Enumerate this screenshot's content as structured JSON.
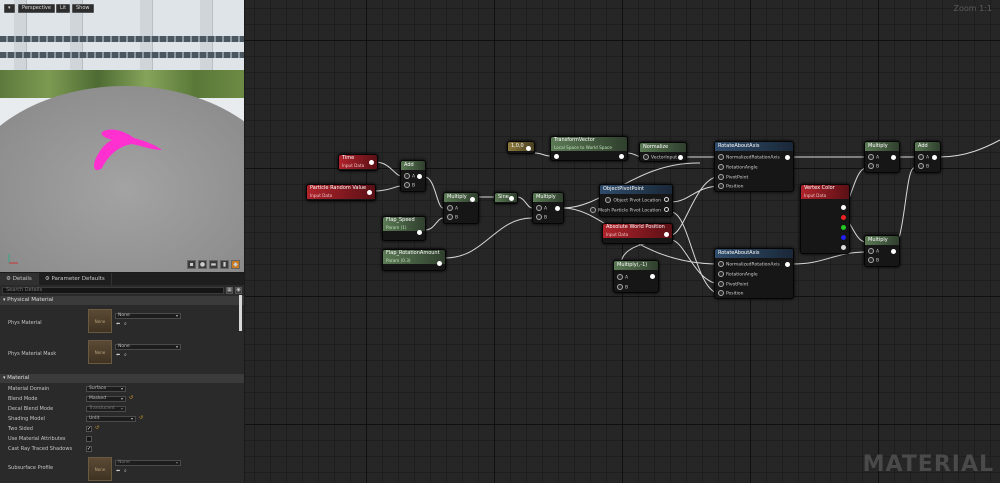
{
  "viewport": {
    "buttons": [
      "Perspective",
      "Lit",
      "Show"
    ]
  },
  "details_panel": {
    "tabs": [
      "Details",
      "Parameter Defaults"
    ],
    "search_placeholder": "Search Details",
    "physical_material": {
      "header": "Physical Material",
      "rows": [
        {
          "label": "Phys Material",
          "thumb": "None",
          "value": "None"
        },
        {
          "label": "Phys Material Mask",
          "thumb": "None",
          "value": "None"
        }
      ]
    },
    "material": {
      "header": "Material",
      "rows": [
        {
          "label": "Material Domain",
          "value": "Surface"
        },
        {
          "label": "Blend Mode",
          "value": "Masked"
        },
        {
          "label": "Decal Blend Mode",
          "value": "Translucent"
        },
        {
          "label": "Shading Model",
          "value": "Unlit"
        },
        {
          "label": "Two Sided",
          "checked": true
        },
        {
          "label": "Use Material Attributes",
          "checked": false
        },
        {
          "label": "Cast Ray Traced Shadows",
          "checked": true
        }
      ],
      "subsurface": {
        "label": "Subsurface Profile",
        "thumb": "None",
        "value": "None"
      }
    }
  },
  "graph": {
    "zoom": "Zoom 1:1",
    "watermark": "MATERIAL",
    "nodes": {
      "time": {
        "title": "Time",
        "subtitle": "Input Data"
      },
      "particle_random": {
        "title": "Particle Random Value",
        "subtitle": "Input Data"
      },
      "add1": {
        "title": "Add",
        "pins": [
          "A",
          "B"
        ]
      },
      "flap_speed": {
        "title": "Flap_Speed",
        "subtitle": "Param (1)"
      },
      "flap_rotation": {
        "title": "Flap_RotationAmount",
        "subtitle": "Param (0.3)"
      },
      "multiply1": {
        "title": "Multiply",
        "pins": [
          "A",
          "B"
        ]
      },
      "sine": {
        "title": "Sine"
      },
      "multiply2": {
        "title": "Multiply",
        "pins": [
          "A",
          "B"
        ]
      },
      "vec": {
        "title": "1,0,0"
      },
      "transform": {
        "title": "TransformVector",
        "subtitle": "Local Space to World Space"
      },
      "normalize": {
        "title": "Normalize",
        "pins": [
          "VectorInput"
        ]
      },
      "object_pivot": {
        "title": "ObjectPivotPoint",
        "outputs": [
          "Object Pivot Location",
          "Mesh Particle Pivot Location"
        ]
      },
      "abs_world": {
        "title": "Absolute World Position",
        "subtitle": "Input Data"
      },
      "multiply_neg": {
        "title": "Multiply(,-1)",
        "pins": [
          "A",
          "B"
        ]
      },
      "rotate1": {
        "title": "RotateAboutAxis",
        "pins": [
          "NormalizedRotationAxis",
          "RotationAngle",
          "PivotPoint",
          "Position"
        ]
      },
      "rotate2": {
        "title": "RotateAboutAxis",
        "pins": [
          "NormalizedRotationAxis",
          "RotationAngle",
          "PivotPoint",
          "Position"
        ]
      },
      "vertex_color": {
        "title": "Vertex Color",
        "subtitle": "Input Data"
      },
      "multiply3": {
        "title": "Multiply",
        "pins": [
          "A",
          "B"
        ]
      },
      "multiply4": {
        "title": "Multiply",
        "pins": [
          "A",
          "B"
        ]
      },
      "add2": {
        "title": "Add",
        "pins": [
          "A",
          "B"
        ]
      }
    }
  },
  "colors": {
    "param_header": "#5b7a55",
    "input_header": "#b0232b",
    "function_header": "#2f4c6b",
    "constant_header": "#8c7a3b",
    "butterfly": "#ff2fd0"
  }
}
